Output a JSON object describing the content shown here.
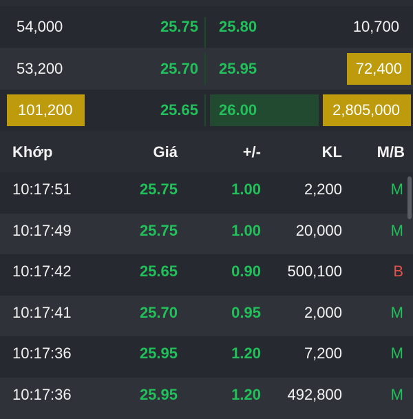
{
  "order_book": [
    {
      "bid_vol": "54,000",
      "bid_price": "25.75",
      "ask_price": "25.80",
      "ask_vol": "10,700"
    },
    {
      "bid_vol": "53,200",
      "bid_price": "25.70",
      "ask_price": "25.95",
      "ask_vol": "72,400"
    },
    {
      "bid_vol": "101,200",
      "bid_price": "25.65",
      "ask_price": "26.00",
      "ask_vol": "2,805,000"
    }
  ],
  "table": {
    "headers": {
      "time": "Khớp",
      "price": "Giá",
      "change": "+/-",
      "volume": "KL",
      "side": "M/B"
    },
    "rows": [
      {
        "time": "10:17:51",
        "price": "25.75",
        "change": "1.00",
        "volume": "2,200",
        "side": "M"
      },
      {
        "time": "10:17:49",
        "price": "25.75",
        "change": "1.00",
        "volume": "20,000",
        "side": "M"
      },
      {
        "time": "10:17:42",
        "price": "25.65",
        "change": "0.90",
        "volume": "500,100",
        "side": "B"
      },
      {
        "time": "10:17:41",
        "price": "25.70",
        "change": "0.95",
        "volume": "2,000",
        "side": "M"
      },
      {
        "time": "10:17:36",
        "price": "25.95",
        "change": "1.20",
        "volume": "7,200",
        "side": "M"
      },
      {
        "time": "10:17:36",
        "price": "25.95",
        "change": "1.20",
        "volume": "492,800",
        "side": "M"
      }
    ]
  },
  "colors": {
    "up": "#21c05a",
    "sell": "#e0524a",
    "highlight": "#bd9b0d",
    "background": "#2a2d33"
  }
}
